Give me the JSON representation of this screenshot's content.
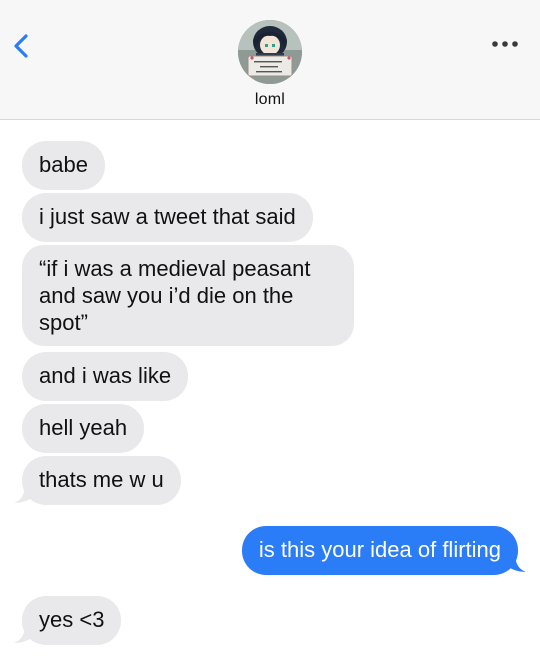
{
  "header": {
    "contact_name": "loml",
    "avatar_sign_text": "i need mental help immediately"
  },
  "messages": [
    {
      "from": "them",
      "text": "babe"
    },
    {
      "from": "them",
      "text": "i just saw a tweet that said"
    },
    {
      "from": "them",
      "text": "“if i was a medieval peasant and saw you i’d die on the spot”"
    },
    {
      "from": "them",
      "text": "and i was like"
    },
    {
      "from": "them",
      "text": "hell yeah"
    },
    {
      "from": "them",
      "text": "thats me w u"
    },
    {
      "from": "me",
      "text": "is this your idea of flirting"
    },
    {
      "from": "them",
      "text": "yes <3"
    }
  ],
  "colors": {
    "accent": "#2b7cf7",
    "received_bubble": "#e9e9eb",
    "header_bg": "#f7f7f7"
  },
  "icons": {
    "back": "chevron-left-icon",
    "more": "more-options-icon"
  }
}
